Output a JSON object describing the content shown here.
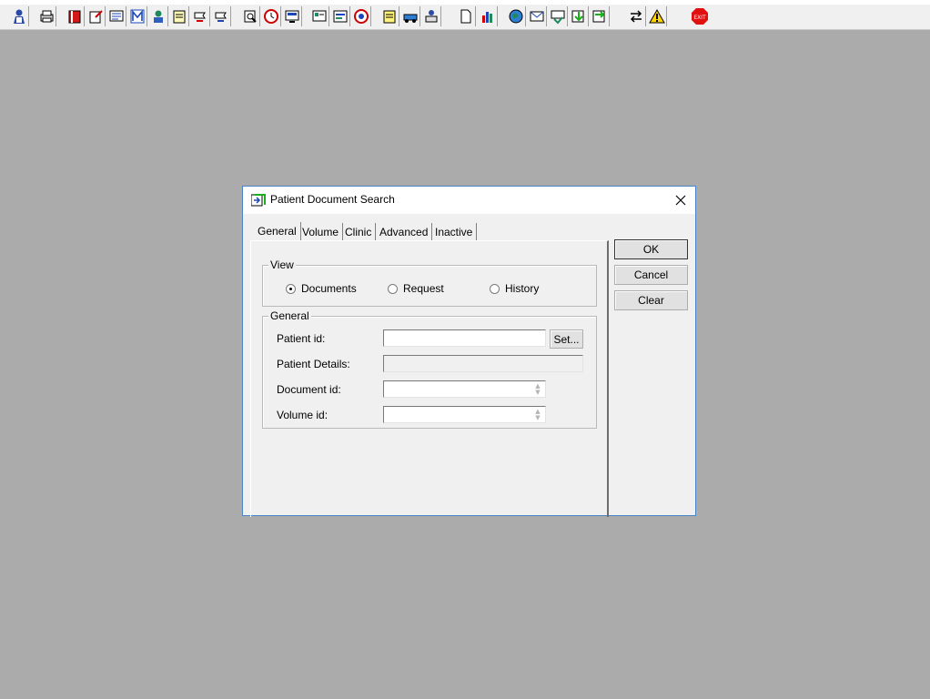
{
  "dialog": {
    "title": "Patient Document Search",
    "tabs": [
      {
        "label": "General",
        "active": true
      },
      {
        "label": "Volume",
        "active": false
      },
      {
        "label": "Clinic",
        "active": false
      },
      {
        "label": "Advanced",
        "active": false
      },
      {
        "label": "Inactive",
        "active": false
      }
    ],
    "view_group": {
      "title": "View",
      "options": [
        {
          "label": "Documents",
          "selected": true
        },
        {
          "label": "Request",
          "selected": false
        },
        {
          "label": "History",
          "selected": false
        }
      ]
    },
    "general_group": {
      "title": "General",
      "patient_id_label": "Patient id:",
      "patient_id_value": "",
      "set_button": "Set...",
      "patient_details_label": "Patient Details:",
      "patient_details_value": "",
      "document_id_label": "Document id:",
      "document_id_value": "",
      "volume_id_label": "Volume id:",
      "volume_id_value": ""
    },
    "buttons": {
      "ok": "OK",
      "cancel": "Cancel",
      "clear": "Clear"
    }
  },
  "toolbar": {
    "icons": [
      "user-icon",
      "print-icon",
      "book-icon",
      "edit-form-icon",
      "screen-list-icon",
      "m-icon",
      "person-icon",
      "notes-icon",
      "flag-forward-icon",
      "flag-back-icon",
      "search-document-icon",
      "clock-icon",
      "monitor-icon",
      "chart-icon",
      "card-icon",
      "dial-icon",
      "notepad-icon",
      "transfer-icon",
      "printer-user-icon",
      "page-icon",
      "bar-chart-icon",
      "globe-icon",
      "mail-icon",
      "check-mail-icon",
      "green-arrow-icon",
      "swap-icon",
      "arrows-icon",
      "warning-icon",
      "exit-icon"
    ],
    "exit_label": "EXIT"
  },
  "colors": {
    "desktop": "#ababab",
    "dialog_bg": "#f0f0f0",
    "dialog_border": "#4a84c9"
  }
}
